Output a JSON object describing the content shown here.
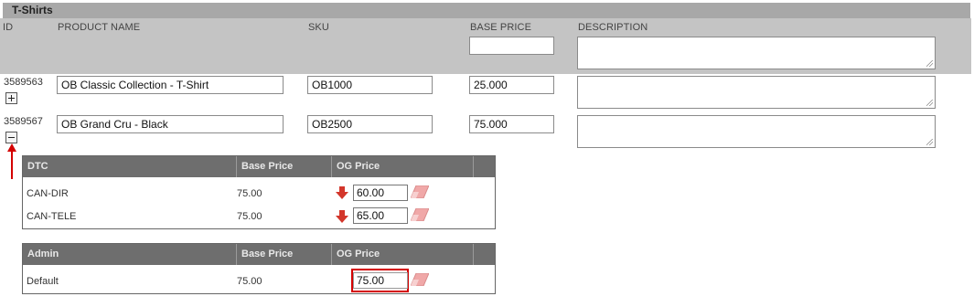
{
  "section_title": "T-Shirts",
  "columns": {
    "id": "ID",
    "product_name": "PRODUCT NAME",
    "sku": "SKU",
    "base_price": "BASE PRICE",
    "description": "DESCRIPTION"
  },
  "filter": {
    "base_price": "",
    "description": ""
  },
  "products": [
    {
      "id": "3589563",
      "name": "OB Classic Collection - T-Shirt",
      "sku": "OB1000",
      "base_price": "25.000",
      "description": "",
      "expanded": false
    },
    {
      "id": "3589567",
      "name": "OB Grand Cru - Black",
      "sku": "OB2500",
      "base_price": "75.000",
      "description": "",
      "expanded": true
    }
  ],
  "price_groups": [
    {
      "group": "DTC",
      "col_base": "Base Price",
      "col_og": "OG Price",
      "rows": [
        {
          "name": "CAN-DIR",
          "base": "75.00",
          "og": "60.00",
          "decrease": true
        },
        {
          "name": "CAN-TELE",
          "base": "75.00",
          "og": "65.00",
          "decrease": true
        }
      ]
    },
    {
      "group": "Admin",
      "col_base": "Base Price",
      "col_og": "OG Price",
      "rows": [
        {
          "name": "Default",
          "base": "75.00",
          "og": "75.00",
          "decrease": false,
          "highlighted": true
        }
      ]
    }
  ],
  "colors": {
    "title_bar": "#a8a8a8",
    "header_bg": "#c4c4c4",
    "subtable_header": "#6e6e6e",
    "annotation_red": "#d40000",
    "down_arrow": "#d3362b",
    "eraser": "#f0a8a8"
  }
}
